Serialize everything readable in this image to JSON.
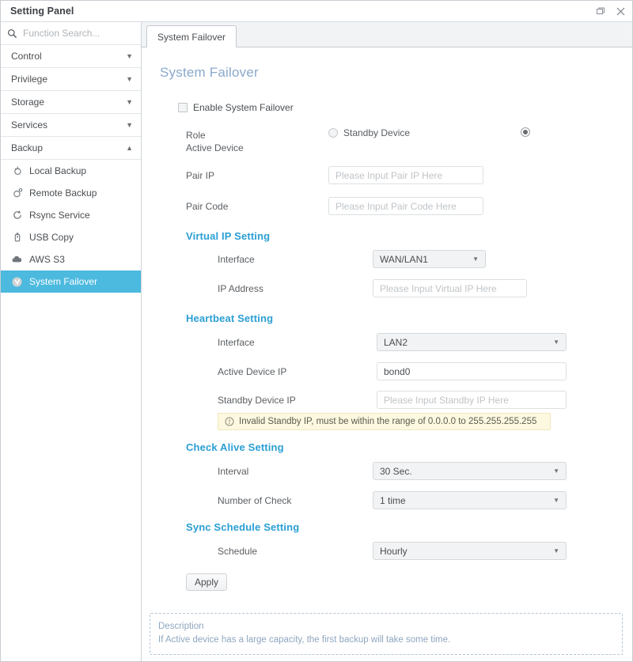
{
  "window": {
    "title": "Setting Panel",
    "restore_label": "restore-icon",
    "close_label": "close-icon"
  },
  "sidebar": {
    "search": {
      "placeholder": "Function Search...",
      "value": "",
      "icon": "search-icon"
    },
    "groups": [
      {
        "label": "Control",
        "caret": "▼",
        "expanded": false
      },
      {
        "label": "Privilege",
        "caret": "▼",
        "expanded": false
      },
      {
        "label": "Storage",
        "caret": "▼",
        "expanded": false
      },
      {
        "label": "Services",
        "caret": "▼",
        "expanded": false
      },
      {
        "label": "Backup",
        "caret": "▲",
        "expanded": true
      }
    ],
    "backup_items": [
      {
        "label": "Local Backup",
        "icon": "local-backup-icon",
        "selected": false
      },
      {
        "label": "Remote Backup",
        "icon": "remote-backup-icon",
        "selected": false
      },
      {
        "label": "Rsync Service",
        "icon": "rsync-icon",
        "selected": false
      },
      {
        "label": "USB Copy",
        "icon": "usb-copy-icon",
        "selected": false
      },
      {
        "label": "AWS S3",
        "icon": "cloud-icon",
        "selected": false
      },
      {
        "label": "System Failover",
        "icon": "failover-icon",
        "selected": true
      }
    ]
  },
  "tabs": [
    {
      "label": "System Failover",
      "active": true
    }
  ],
  "main": {
    "page_title": "System Failover",
    "enable_checkbox": {
      "label": "Enable System Failover",
      "checked": false
    },
    "role": {
      "label_line1": "Role",
      "label_line2": "Active Device",
      "standby_label": "Standby Device",
      "standby_selected": false,
      "active_selected": true
    },
    "pair_ip": {
      "label": "Pair IP",
      "placeholder": "Please Input Pair IP Here",
      "value": ""
    },
    "pair_code": {
      "label": "Pair Code",
      "placeholder": "Please Input Pair Code Here",
      "value": ""
    },
    "virtual_ip": {
      "heading": "Virtual IP Setting",
      "interface": {
        "label": "Interface",
        "value": "WAN/LAN1",
        "arrow": "▼"
      },
      "ip_address": {
        "label": "IP Address",
        "placeholder": "Please Input Virtual IP Here",
        "value": ""
      }
    },
    "heartbeat": {
      "heading": "Heartbeat Setting",
      "interface": {
        "label": "Interface",
        "value": "LAN2",
        "arrow": "▼"
      },
      "active_device_ip": {
        "label": "Active Device IP",
        "value": "bond0",
        "placeholder": ""
      },
      "standby_device_ip": {
        "label": "Standby Device IP",
        "placeholder": "Please Input Standby IP Here",
        "value": ""
      },
      "warning": {
        "icon": "exclamation-circle-icon",
        "text": "Invalid Standby IP, must be within the range of 0.0.0.0 to 255.255.255.255"
      }
    },
    "check_alive": {
      "heading": "Check Alive Setting",
      "interval": {
        "label": "Interval",
        "value": "30 Sec.",
        "arrow": "▼"
      },
      "number_of_check": {
        "label": "Number of Check",
        "value": "1 time",
        "arrow": "▼"
      }
    },
    "sync_schedule": {
      "heading": "Sync Schedule Setting",
      "schedule": {
        "label": "Schedule",
        "value": "Hourly",
        "arrow": "▼"
      }
    },
    "apply_label": "Apply",
    "description": {
      "title": "Description",
      "text": "If Active device has a large capacity, the first backup will take some time."
    }
  },
  "colors": {
    "accent": "#2b9fd4",
    "selected_item": "#4cb9de",
    "page_title": "#8aa9cc",
    "warning_bg": "#fdf8e0",
    "description_text": "#8fa6bf"
  }
}
